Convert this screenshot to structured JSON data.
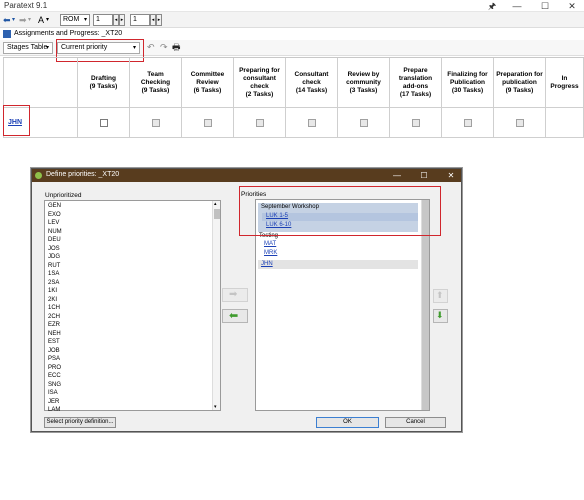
{
  "app": {
    "title": "Paratext 9.1"
  },
  "window_buttons": {
    "pin": "🖈",
    "minimize": "—",
    "maximize": "☐",
    "close": "✕"
  },
  "toolbar": {
    "font_label": "A",
    "book": "ROM",
    "chapter": "1",
    "verse": "1"
  },
  "inner_window": {
    "title": "Assignments and Progress: _XT20"
  },
  "strip": {
    "view": "Stages Table",
    "priority": "Current priority"
  },
  "table": {
    "columns": [
      {
        "label": "Drafting\n(9 Tasks)"
      },
      {
        "label": "Team Checking\n(9 Tasks)"
      },
      {
        "label": "Committee Review\n(6 Tasks)"
      },
      {
        "label": "Preparing for consultant check\n(2 Tasks)"
      },
      {
        "label": "Consultant check\n(14 Tasks)"
      },
      {
        "label": "Review by community\n(3 Tasks)"
      },
      {
        "label": "Prepare translation add-ons\n(17 Tasks)"
      },
      {
        "label": "Finalizing for Publication\n(30 Tasks)"
      },
      {
        "label": "Preparation for publication\n(9 Tasks)"
      },
      {
        "label": "In Progress"
      }
    ],
    "rows": [
      {
        "book": "JHN"
      }
    ]
  },
  "dialog": {
    "title": "Define priorities: _XT20",
    "unprioritized_label": "Unprioritized",
    "priorities_label": "Priorities",
    "unprioritized": [
      "GEN",
      "EXO",
      "LEV",
      "NUM",
      "DEU",
      "JOS",
      "JDG",
      "RUT",
      "1SA",
      "2SA",
      "1KI",
      "2KI",
      "1CH",
      "2CH",
      "EZR",
      "NEH",
      "EST",
      "JOB",
      "PSA",
      "PRO",
      "ECC",
      "SNG",
      "ISA",
      "JER",
      "LAM"
    ],
    "groups": [
      {
        "name": "September Workshop",
        "items": [
          "LUK 1-5",
          "LUK 6-10"
        ]
      },
      {
        "name": "Testing",
        "items": [
          "MAT",
          "MRK"
        ]
      },
      {
        "name": "",
        "items": [
          "JHN"
        ]
      }
    ],
    "select_button": "Select priority definition...",
    "ok_button": "OK",
    "cancel_button": "Cancel"
  }
}
